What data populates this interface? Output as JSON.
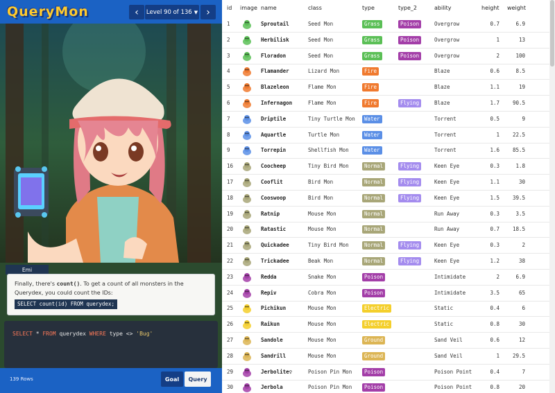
{
  "app": {
    "logo": "QueryMon",
    "level_label": "Level 90 of 136",
    "prev_icon": "chevron-left-icon",
    "next_icon": "chevron-right-icon"
  },
  "dialog": {
    "speaker": "Emi",
    "text_before": "Finally, there's ",
    "code": "count()",
    "text_after": ". To get a count of all monsters in the Querydex, you could count the IDs:",
    "sql": "SELECT count(id) FROM querydex;"
  },
  "editor": {
    "kw1": "SELECT",
    "star": " * ",
    "kw2": "FROM",
    "mid": " querydex ",
    "kw3": "WHERE",
    "cond": " type <> ",
    "str": "'Bug'"
  },
  "footer": {
    "rows": "139 Rows",
    "goal": "Goal",
    "query": "Query"
  },
  "table": {
    "headers": [
      "id",
      "image",
      "name",
      "class",
      "type",
      "type_2",
      "ability",
      "height",
      "weight"
    ],
    "type_colors": {
      "Grass": "#5bbf56",
      "Poison": "#a33ea8",
      "Fire": "#f07a2f",
      "Flying": "#a48cee",
      "Water": "#5b8fe6",
      "Normal": "#a8a678",
      "Electric": "#f4cf2c",
      "Ground": "#dcb554"
    },
    "rows": [
      {
        "id": "1",
        "name": "Sproutail",
        "class": "Seed Mon",
        "type": "Grass",
        "type_2": "Poison",
        "ability": "Overgrow",
        "height": "0.7",
        "weight": "6.9"
      },
      {
        "id": "2",
        "name": "Herbilisk",
        "class": "Seed Mon",
        "type": "Grass",
        "type_2": "Poison",
        "ability": "Overgrow",
        "height": "1",
        "weight": "13"
      },
      {
        "id": "3",
        "name": "Floradon",
        "class": "Seed Mon",
        "type": "Grass",
        "type_2": "Poison",
        "ability": "Overgrow",
        "height": "2",
        "weight": "100"
      },
      {
        "id": "4",
        "name": "Flamander",
        "class": "Lizard Mon",
        "type": "Fire",
        "type_2": "",
        "ability": "Blaze",
        "height": "0.6",
        "weight": "8.5"
      },
      {
        "id": "5",
        "name": "Blazeleon",
        "class": "Flame Mon",
        "type": "Fire",
        "type_2": "",
        "ability": "Blaze",
        "height": "1.1",
        "weight": "19"
      },
      {
        "id": "6",
        "name": "Infernagon",
        "class": "Flame Mon",
        "type": "Fire",
        "type_2": "Flying",
        "ability": "Blaze",
        "height": "1.7",
        "weight": "90.5"
      },
      {
        "id": "7",
        "name": "Driptile",
        "class": "Tiny Turtle Mon",
        "type": "Water",
        "type_2": "",
        "ability": "Torrent",
        "height": "0.5",
        "weight": "9"
      },
      {
        "id": "8",
        "name": "Aquartle",
        "class": "Turtle Mon",
        "type": "Water",
        "type_2": "",
        "ability": "Torrent",
        "height": "1",
        "weight": "22.5"
      },
      {
        "id": "9",
        "name": "Torrepin",
        "class": "Shellfish Mon",
        "type": "Water",
        "type_2": "",
        "ability": "Torrent",
        "height": "1.6",
        "weight": "85.5"
      },
      {
        "id": "16",
        "name": "Coocheep",
        "class": "Tiny Bird Mon",
        "type": "Normal",
        "type_2": "Flying",
        "ability": "Keen Eye",
        "height": "0.3",
        "weight": "1.8"
      },
      {
        "id": "17",
        "name": "Cooflit",
        "class": "Bird Mon",
        "type": "Normal",
        "type_2": "Flying",
        "ability": "Keen Eye",
        "height": "1.1",
        "weight": "30"
      },
      {
        "id": "18",
        "name": "Cooswoop",
        "class": "Bird Mon",
        "type": "Normal",
        "type_2": "Flying",
        "ability": "Keen Eye",
        "height": "1.5",
        "weight": "39.5"
      },
      {
        "id": "19",
        "name": "Ratnip",
        "class": "Mouse Mon",
        "type": "Normal",
        "type_2": "",
        "ability": "Run Away",
        "height": "0.3",
        "weight": "3.5"
      },
      {
        "id": "20",
        "name": "Ratastic",
        "class": "Mouse Mon",
        "type": "Normal",
        "type_2": "",
        "ability": "Run Away",
        "height": "0.7",
        "weight": "18.5"
      },
      {
        "id": "21",
        "name": "Quickadee",
        "class": "Tiny Bird Mon",
        "type": "Normal",
        "type_2": "Flying",
        "ability": "Keen Eye",
        "height": "0.3",
        "weight": "2"
      },
      {
        "id": "22",
        "name": "Trickadee",
        "class": "Beak Mon",
        "type": "Normal",
        "type_2": "Flying",
        "ability": "Keen Eye",
        "height": "1.2",
        "weight": "38"
      },
      {
        "id": "23",
        "name": "Redda",
        "class": "Snake Mon",
        "type": "Poison",
        "type_2": "",
        "ability": "Intimidate",
        "height": "2",
        "weight": "6.9"
      },
      {
        "id": "24",
        "name": "Repiv",
        "class": "Cobra Mon",
        "type": "Poison",
        "type_2": "",
        "ability": "Intimidate",
        "height": "3.5",
        "weight": "65"
      },
      {
        "id": "25",
        "name": "Pichikun",
        "class": "Mouse Mon",
        "type": "Electric",
        "type_2": "",
        "ability": "Static",
        "height": "0.4",
        "weight": "6"
      },
      {
        "id": "26",
        "name": "Raikun",
        "class": "Mouse Mon",
        "type": "Electric",
        "type_2": "",
        "ability": "Static",
        "height": "0.8",
        "weight": "30"
      },
      {
        "id": "27",
        "name": "Sandole",
        "class": "Mouse Mon",
        "type": "Ground",
        "type_2": "",
        "ability": "Sand Veil",
        "height": "0.6",
        "weight": "12"
      },
      {
        "id": "28",
        "name": "Sandrill",
        "class": "Mouse Mon",
        "type": "Ground",
        "type_2": "",
        "ability": "Sand Veil",
        "height": "1",
        "weight": "29.5"
      },
      {
        "id": "29",
        "name": "Jerbolite♀",
        "class": "Poison Pin Mon",
        "type": "Poison",
        "type_2": "",
        "ability": "Poison Point",
        "height": "0.4",
        "weight": "7"
      },
      {
        "id": "30",
        "name": "Jerbola",
        "class": "Poison Pin Mon",
        "type": "Poison",
        "type_2": "",
        "ability": "Poison Point",
        "height": "0.8",
        "weight": "20"
      }
    ]
  }
}
